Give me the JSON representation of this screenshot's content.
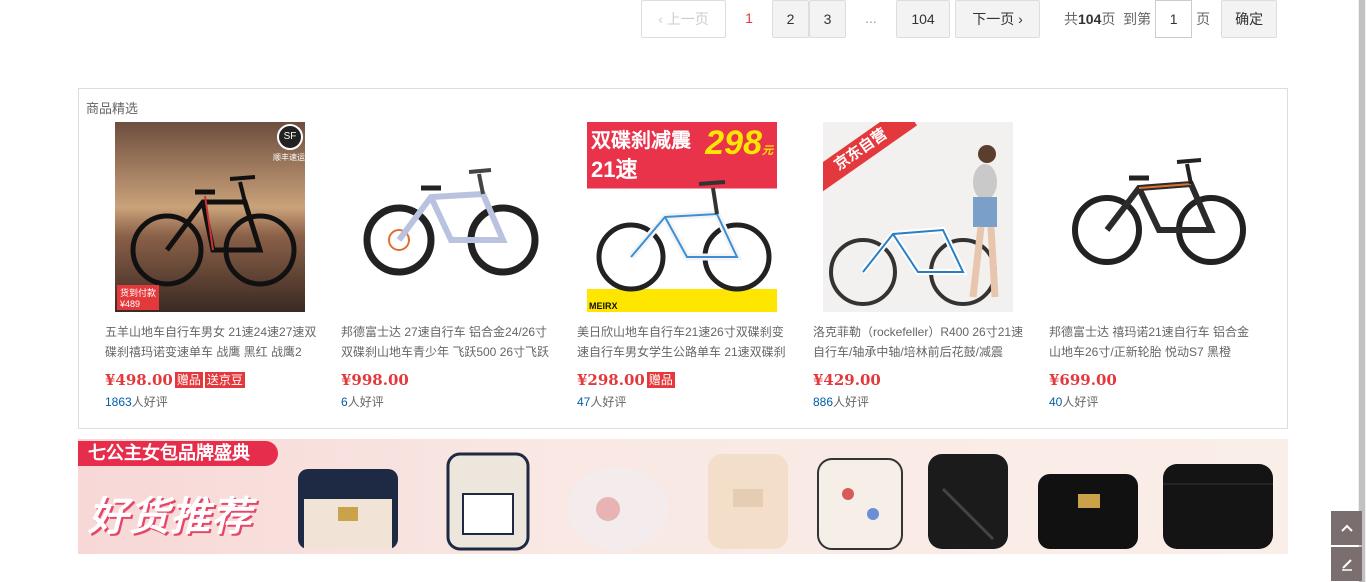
{
  "pagination": {
    "prev": "上一页",
    "current": "1",
    "pages": [
      "2",
      "3"
    ],
    "ellipsis": "...",
    "last": "104",
    "next": "下一页",
    "total_prefix": "共",
    "total": "104",
    "total_suffix": "页",
    "goto_prefix": "到第",
    "goto_value": "1",
    "goto_suffix": "页",
    "confirm": "确定"
  },
  "selected": {
    "title": "商品精选",
    "items": [
      {
        "name": "五羊山地车自行车男女 21速24速27速双碟刹禧玛诺变速单车 战鹰 黑红 战鹰2",
        "price": "¥498.00",
        "tags": [
          "赠品",
          "送京豆"
        ],
        "reviews": "1863",
        "review_suffix": "人好评"
      },
      {
        "name": "邦德富士达 27速自行车 铝合金24/26寸双碟刹山地车青少年 飞跃500 26寸飞跃",
        "price": "¥998.00",
        "tags": [],
        "reviews": "6",
        "review_suffix": "人好评"
      },
      {
        "name": "美日欣山地车自行车21速26寸双碟刹变速自行车男女学生公路单车 21速双碟刹",
        "price": "¥298.00",
        "tags": [
          "赠品"
        ],
        "reviews": "47",
        "review_suffix": "人好评"
      },
      {
        "name": "洛克菲勒（rockefeller）R400 26寸21速自行车/轴承中轴/培林前后花鼓/减震",
        "price": "¥429.00",
        "tags": [],
        "reviews": "886",
        "review_suffix": "人好评"
      },
      {
        "name": "邦德富士达 禧玛诺21速自行车 铝合金山地车26寸/正新轮胎 悦动S7 黑橙",
        "price": "¥699.00",
        "tags": [],
        "reviews": "40",
        "review_suffix": "人好评"
      }
    ],
    "image_texts": {
      "sf": "顺丰速运",
      "cod": "货到付款",
      "cod_price": "¥489",
      "promo_head": "双碟刹减震",
      "promo_speed": "21速",
      "promo_price": "298",
      "promo_unit": "元",
      "promo_brand": "MEIRX",
      "jd": "京东自营"
    }
  },
  "banner": {
    "tag": "七公主女包品牌盛典",
    "headline": "好货推荐"
  },
  "colors": {
    "accent": "#e4393c",
    "link": "#005ea7",
    "banner_red": "#e72d4c"
  }
}
